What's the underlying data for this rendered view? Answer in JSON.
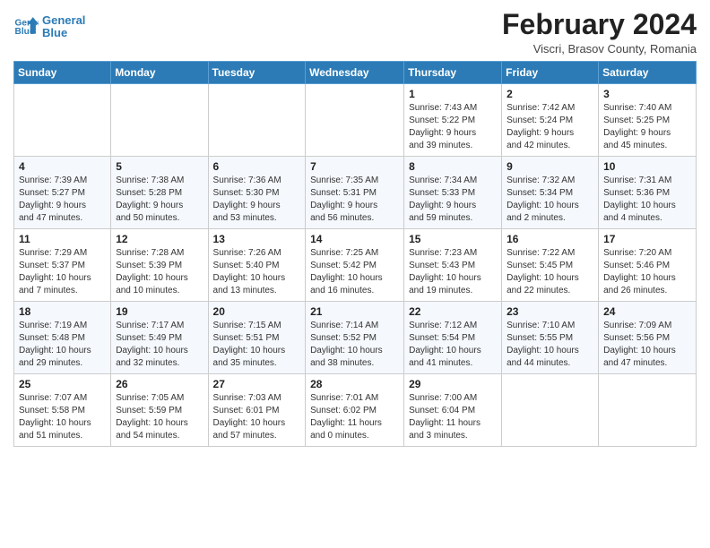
{
  "header": {
    "logo_line1": "General",
    "logo_line2": "Blue",
    "month_year": "February 2024",
    "location": "Viscri, Brasov County, Romania"
  },
  "days_of_week": [
    "Sunday",
    "Monday",
    "Tuesday",
    "Wednesday",
    "Thursday",
    "Friday",
    "Saturday"
  ],
  "weeks": [
    [
      {
        "day": "",
        "info": ""
      },
      {
        "day": "",
        "info": ""
      },
      {
        "day": "",
        "info": ""
      },
      {
        "day": "",
        "info": ""
      },
      {
        "day": "1",
        "info": "Sunrise: 7:43 AM\nSunset: 5:22 PM\nDaylight: 9 hours\nand 39 minutes."
      },
      {
        "day": "2",
        "info": "Sunrise: 7:42 AM\nSunset: 5:24 PM\nDaylight: 9 hours\nand 42 minutes."
      },
      {
        "day": "3",
        "info": "Sunrise: 7:40 AM\nSunset: 5:25 PM\nDaylight: 9 hours\nand 45 minutes."
      }
    ],
    [
      {
        "day": "4",
        "info": "Sunrise: 7:39 AM\nSunset: 5:27 PM\nDaylight: 9 hours\nand 47 minutes."
      },
      {
        "day": "5",
        "info": "Sunrise: 7:38 AM\nSunset: 5:28 PM\nDaylight: 9 hours\nand 50 minutes."
      },
      {
        "day": "6",
        "info": "Sunrise: 7:36 AM\nSunset: 5:30 PM\nDaylight: 9 hours\nand 53 minutes."
      },
      {
        "day": "7",
        "info": "Sunrise: 7:35 AM\nSunset: 5:31 PM\nDaylight: 9 hours\nand 56 minutes."
      },
      {
        "day": "8",
        "info": "Sunrise: 7:34 AM\nSunset: 5:33 PM\nDaylight: 9 hours\nand 59 minutes."
      },
      {
        "day": "9",
        "info": "Sunrise: 7:32 AM\nSunset: 5:34 PM\nDaylight: 10 hours\nand 2 minutes."
      },
      {
        "day": "10",
        "info": "Sunrise: 7:31 AM\nSunset: 5:36 PM\nDaylight: 10 hours\nand 4 minutes."
      }
    ],
    [
      {
        "day": "11",
        "info": "Sunrise: 7:29 AM\nSunset: 5:37 PM\nDaylight: 10 hours\nand 7 minutes."
      },
      {
        "day": "12",
        "info": "Sunrise: 7:28 AM\nSunset: 5:39 PM\nDaylight: 10 hours\nand 10 minutes."
      },
      {
        "day": "13",
        "info": "Sunrise: 7:26 AM\nSunset: 5:40 PM\nDaylight: 10 hours\nand 13 minutes."
      },
      {
        "day": "14",
        "info": "Sunrise: 7:25 AM\nSunset: 5:42 PM\nDaylight: 10 hours\nand 16 minutes."
      },
      {
        "day": "15",
        "info": "Sunrise: 7:23 AM\nSunset: 5:43 PM\nDaylight: 10 hours\nand 19 minutes."
      },
      {
        "day": "16",
        "info": "Sunrise: 7:22 AM\nSunset: 5:45 PM\nDaylight: 10 hours\nand 22 minutes."
      },
      {
        "day": "17",
        "info": "Sunrise: 7:20 AM\nSunset: 5:46 PM\nDaylight: 10 hours\nand 26 minutes."
      }
    ],
    [
      {
        "day": "18",
        "info": "Sunrise: 7:19 AM\nSunset: 5:48 PM\nDaylight: 10 hours\nand 29 minutes."
      },
      {
        "day": "19",
        "info": "Sunrise: 7:17 AM\nSunset: 5:49 PM\nDaylight: 10 hours\nand 32 minutes."
      },
      {
        "day": "20",
        "info": "Sunrise: 7:15 AM\nSunset: 5:51 PM\nDaylight: 10 hours\nand 35 minutes."
      },
      {
        "day": "21",
        "info": "Sunrise: 7:14 AM\nSunset: 5:52 PM\nDaylight: 10 hours\nand 38 minutes."
      },
      {
        "day": "22",
        "info": "Sunrise: 7:12 AM\nSunset: 5:54 PM\nDaylight: 10 hours\nand 41 minutes."
      },
      {
        "day": "23",
        "info": "Sunrise: 7:10 AM\nSunset: 5:55 PM\nDaylight: 10 hours\nand 44 minutes."
      },
      {
        "day": "24",
        "info": "Sunrise: 7:09 AM\nSunset: 5:56 PM\nDaylight: 10 hours\nand 47 minutes."
      }
    ],
    [
      {
        "day": "25",
        "info": "Sunrise: 7:07 AM\nSunset: 5:58 PM\nDaylight: 10 hours\nand 51 minutes."
      },
      {
        "day": "26",
        "info": "Sunrise: 7:05 AM\nSunset: 5:59 PM\nDaylight: 10 hours\nand 54 minutes."
      },
      {
        "day": "27",
        "info": "Sunrise: 7:03 AM\nSunset: 6:01 PM\nDaylight: 10 hours\nand 57 minutes."
      },
      {
        "day": "28",
        "info": "Sunrise: 7:01 AM\nSunset: 6:02 PM\nDaylight: 11 hours\nand 0 minutes."
      },
      {
        "day": "29",
        "info": "Sunrise: 7:00 AM\nSunset: 6:04 PM\nDaylight: 11 hours\nand 3 minutes."
      },
      {
        "day": "",
        "info": ""
      },
      {
        "day": "",
        "info": ""
      }
    ]
  ]
}
